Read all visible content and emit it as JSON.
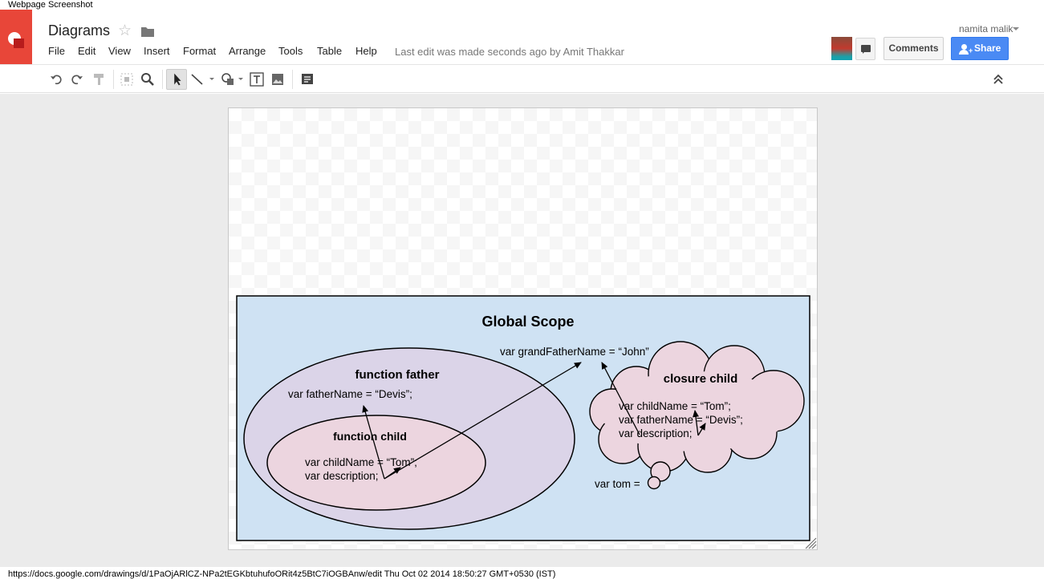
{
  "caption": {
    "top": "Webpage Screenshot",
    "bottom": "https://docs.google.com/drawings/d/1PaOjARlCZ-NPa2tEGKbtuhufoORit4z5BtC7iOGBAnw/edit Thu Oct 02 2014 18:50:27 GMT+0530 (IST)"
  },
  "header": {
    "title": "Diagrams",
    "star_icon": "☆",
    "menu": [
      "File",
      "Edit",
      "View",
      "Insert",
      "Format",
      "Arrange",
      "Tools",
      "Table",
      "Help"
    ],
    "last_edit": "Last edit was made seconds ago by Amit Thakkar",
    "user": "namita malik",
    "comments_label": "Comments",
    "share_label": "Share"
  },
  "toolbar": {
    "icons": [
      "undo-icon",
      "redo-icon",
      "paint-format-icon",
      "zoom-fit-icon",
      "zoom-icon",
      "select-icon",
      "line-icon",
      "shape-icon",
      "textbox-icon",
      "image-icon",
      "comment-icon",
      "collapse-icon"
    ]
  },
  "diagram": {
    "colors": {
      "global": "#cfe2f3",
      "father": "#dbd4e8",
      "child": "#ecd5df",
      "cloud": "#ecd5df"
    },
    "global_title": "Global Scope",
    "grandfather_var": "var grandFatherName = “John”",
    "father_title": "function father",
    "father_var": "var fatherName = “Devis”;",
    "child_title": "function child",
    "child_var1": "var childName = “Tom”;",
    "child_var2": "var description;",
    "closure_title": "closure child",
    "closure_var1": "var childName = “Tom”;",
    "closure_var2": "var fatherName = “Devis”;",
    "closure_var3": "var description;",
    "tom_var": "var tom ="
  }
}
